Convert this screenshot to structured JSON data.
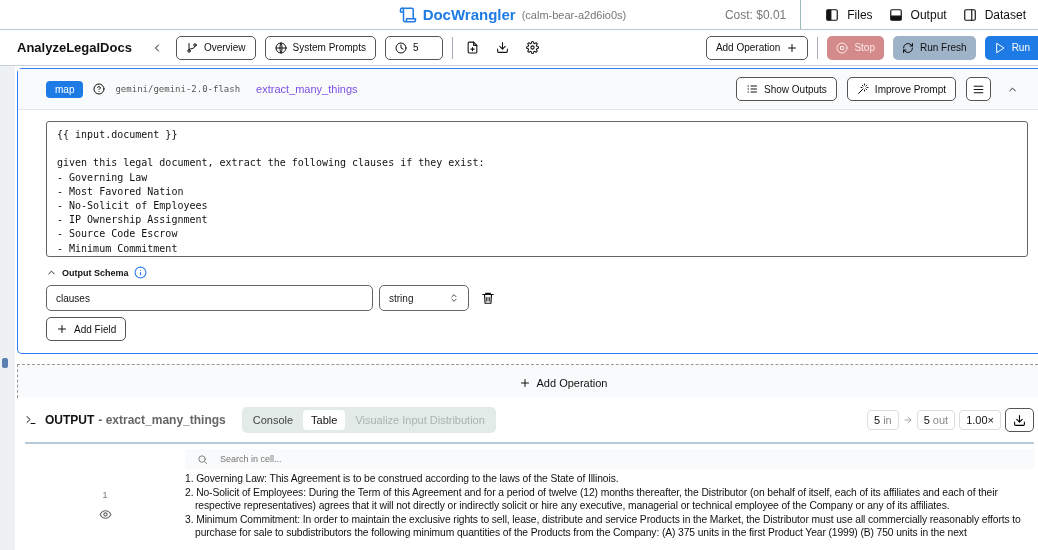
{
  "header": {
    "title": "DocWrangler",
    "session": "(calm-bear-a2d6io0s)",
    "cost": "Cost: $0.01",
    "panels": [
      {
        "kind": "left",
        "label": "Files"
      },
      {
        "kind": "bottom",
        "label": "Output"
      },
      {
        "kind": "right",
        "label": "Dataset"
      }
    ]
  },
  "toolbar": {
    "pipeline_name": "AnalyzeLegalDocs",
    "buttons": [
      {
        "kind": "branch",
        "label": "Overview"
      },
      {
        "kind": "globe",
        "label": "System Prompts"
      }
    ],
    "sample_size": "5",
    "add_operation": "Add Operation",
    "stop": {
      "label": "Stop",
      "disabled": true
    },
    "run_fresh": "Run Fresh",
    "run": "Run"
  },
  "operation": {
    "type": "map",
    "model": "gemini/gemini-2.0-flash",
    "name": "extract_many_things",
    "buttons": [
      {
        "kind": "list",
        "label": "Show Outputs"
      },
      {
        "kind": "wand",
        "label": "Improve Prompt"
      }
    ],
    "expanded": true,
    "prompt": "{{ input.document }}\n\ngiven this legal document, extract the following clauses if they exist:\n- Governing Law\n- Most Favored Nation\n- No-Solicit of Employees\n- IP Ownership Assignment\n- Source Code Escrow\n- Minimum Commitment",
    "schema": {
      "title": "Output Schema",
      "expanded": true,
      "fields": [
        {
          "name": "clauses",
          "type": "string"
        }
      ],
      "add_field": "Add Field"
    }
  },
  "add_operation": "Add Operation",
  "output": {
    "title": "OUTPUT",
    "operation": "- extract_many_things",
    "tabs": [
      {
        "label": "Console",
        "selected": false,
        "disabled": false
      },
      {
        "label": "Table",
        "selected": true,
        "disabled": false
      },
      {
        "label": "Visualize Input Distribution",
        "selected": false,
        "disabled": true
      }
    ],
    "in_count": "5",
    "in_label": "in",
    "out_count": "5",
    "out_label": "out",
    "speed": "1.00×",
    "search_placeholder": "Search in cell...",
    "rows": [
      {
        "index": "1",
        "items": [
          "1. Governing Law: This Agreement is to be construed according to the laws of the State of Illinois.",
          "2. No-Solicit of Employees: During the Term of this Agreement and for a period of twelve (12) months thereafter, the Distributor (on behalf of itself, each of its affiliates and each of their respective representatives) agrees that it will not directly or indirectly solicit or hire any executive, managerial or technical employee of the Company or any of its affiliates.",
          "3. Minimum Commitment: In order to maintain the exclusive rights to sell, lease, distribute and service Products in the Market, the Distributor must use all commercially reasonably efforts to purchase for sale to subdistributors the following minimum quantities of the Products from the Company: (A) 375 units in the first Product Year (1999) (B) 750 units in the next"
        ]
      }
    ]
  }
}
